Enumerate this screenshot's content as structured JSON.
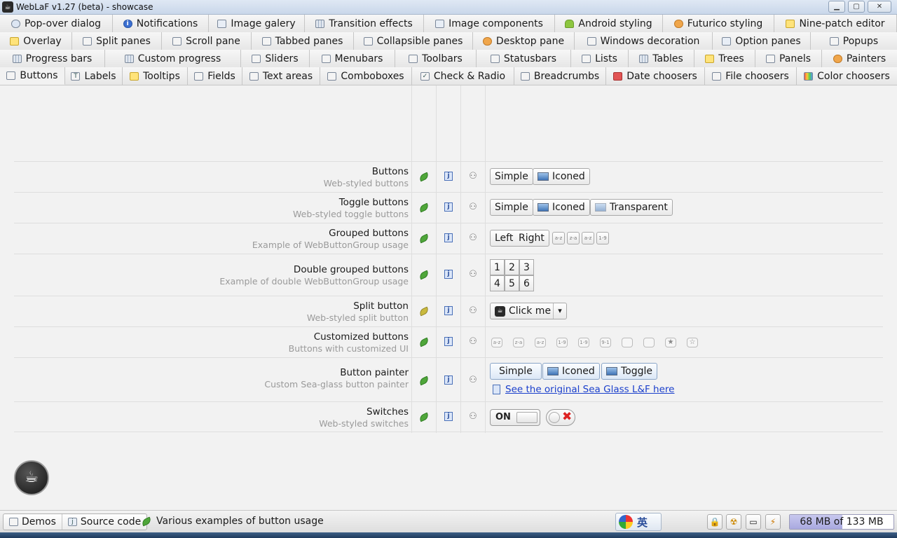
{
  "window": {
    "title": "WebLaF v1.27 (beta) - showcase",
    "minimize": "▁",
    "maximize": "▢",
    "close": "✕"
  },
  "tabs": {
    "row1": [
      {
        "label": "Pop-over dialog",
        "icon": "speech-bubble-icon"
      },
      {
        "label": "Notifications",
        "icon": "info-icon"
      },
      {
        "label": "Image galery",
        "icon": "image-icon"
      },
      {
        "label": "Transition effects",
        "icon": "transition-icon"
      },
      {
        "label": "Image components",
        "icon": "image-icon"
      },
      {
        "label": "Android styling",
        "icon": "android-icon"
      },
      {
        "label": "Futurico styling",
        "icon": "palette-icon"
      },
      {
        "label": "Nine-patch editor",
        "icon": "nine-patch-icon"
      }
    ],
    "row2": [
      {
        "label": "Overlay",
        "icon": "overlay-icon"
      },
      {
        "label": "Split panes",
        "icon": "split-pane-icon"
      },
      {
        "label": "Scroll pane",
        "icon": "scroll-pane-icon"
      },
      {
        "label": "Tabbed panes",
        "icon": "tabbed-pane-icon"
      },
      {
        "label": "Collapsible panes",
        "icon": "collapsible-icon"
      },
      {
        "label": "Desktop pane",
        "icon": "desktop-icon"
      },
      {
        "label": "Windows decoration",
        "icon": "window-icon"
      },
      {
        "label": "Option panes",
        "icon": "option-pane-icon"
      },
      {
        "label": "Popups",
        "icon": "popup-icon"
      }
    ],
    "row3": [
      {
        "label": "Progress bars",
        "icon": "progress-icon"
      },
      {
        "label": "Custom progress",
        "icon": "progress-icon"
      },
      {
        "label": "Sliders",
        "icon": "slider-icon"
      },
      {
        "label": "Menubars",
        "icon": "menubar-icon"
      },
      {
        "label": "Toolbars",
        "icon": "toolbar-icon"
      },
      {
        "label": "Statusbars",
        "icon": "statusbar-icon"
      },
      {
        "label": "Lists",
        "icon": "list-icon"
      },
      {
        "label": "Tables",
        "icon": "table-icon"
      },
      {
        "label": "Trees",
        "icon": "tree-icon"
      },
      {
        "label": "Panels",
        "icon": "panel-icon"
      },
      {
        "label": "Painters",
        "icon": "palette-icon"
      }
    ],
    "row4": [
      {
        "label": "Buttons",
        "icon": "button-icon",
        "active": true
      },
      {
        "label": "Labels",
        "icon": "label-icon"
      },
      {
        "label": "Tooltips",
        "icon": "tooltip-icon"
      },
      {
        "label": "Fields",
        "icon": "field-icon"
      },
      {
        "label": "Text areas",
        "icon": "text-area-icon"
      },
      {
        "label": "Comboboxes",
        "icon": "combobox-icon"
      },
      {
        "label": "Check & Radio",
        "icon": "checkbox-icon"
      },
      {
        "label": "Breadcrumbs",
        "icon": "breadcrumb-icon"
      },
      {
        "label": "Date choosers",
        "icon": "calendar-icon"
      },
      {
        "label": "File choosers",
        "icon": "file-icon"
      },
      {
        "label": "Color choosers",
        "icon": "color-icon"
      }
    ]
  },
  "rows": [
    {
      "title": "Buttons",
      "subtitle": "Web-styled buttons"
    },
    {
      "title": "Toggle buttons",
      "subtitle": "Web-styled toggle buttons"
    },
    {
      "title": "Grouped buttons",
      "subtitle": "Example of WebButtonGroup usage"
    },
    {
      "title": "Double grouped buttons",
      "subtitle": "Example of double WebButtonGroup usage"
    },
    {
      "title": "Split button",
      "subtitle": "Web-styled split button"
    },
    {
      "title": "Customized buttons",
      "subtitle": "Buttons with customized UI"
    },
    {
      "title": "Button painter",
      "subtitle": "Custom Sea-glass button painter"
    },
    {
      "title": "Switches",
      "subtitle": "Web-styled switches"
    }
  ],
  "buttons": {
    "simple": "Simple",
    "iconed": "Iconed",
    "transparent": "Transparent",
    "left": "Left",
    "right": "Right",
    "grid": [
      "1",
      "2",
      "3",
      "4",
      "5",
      "6"
    ],
    "sort_icons": [
      "a-z",
      "z-a",
      "a-z",
      "1-9"
    ],
    "click_me": "Click me",
    "custom_icons": [
      "a-z",
      "z-a",
      "a-z",
      "1-9",
      "1-9",
      "9-1",
      "",
      "",
      "★",
      "☆"
    ],
    "toggle": "Toggle",
    "sea_glass_link": "See the original Sea Glass L&F here",
    "switch_on": "ON",
    "dropdown_arrow": "▾",
    "share_glyph": "⚇"
  },
  "statusbar": {
    "crumbs": [
      "Demos",
      "Source code"
    ],
    "message": "Various examples of button usage",
    "ime_text": "英",
    "memory": "68 MB of 133 MB",
    "memory_used_fraction": 0.51,
    "tools": [
      "lock-icon",
      "radiation-icon",
      "monitor-icon",
      "plug-icon"
    ]
  }
}
